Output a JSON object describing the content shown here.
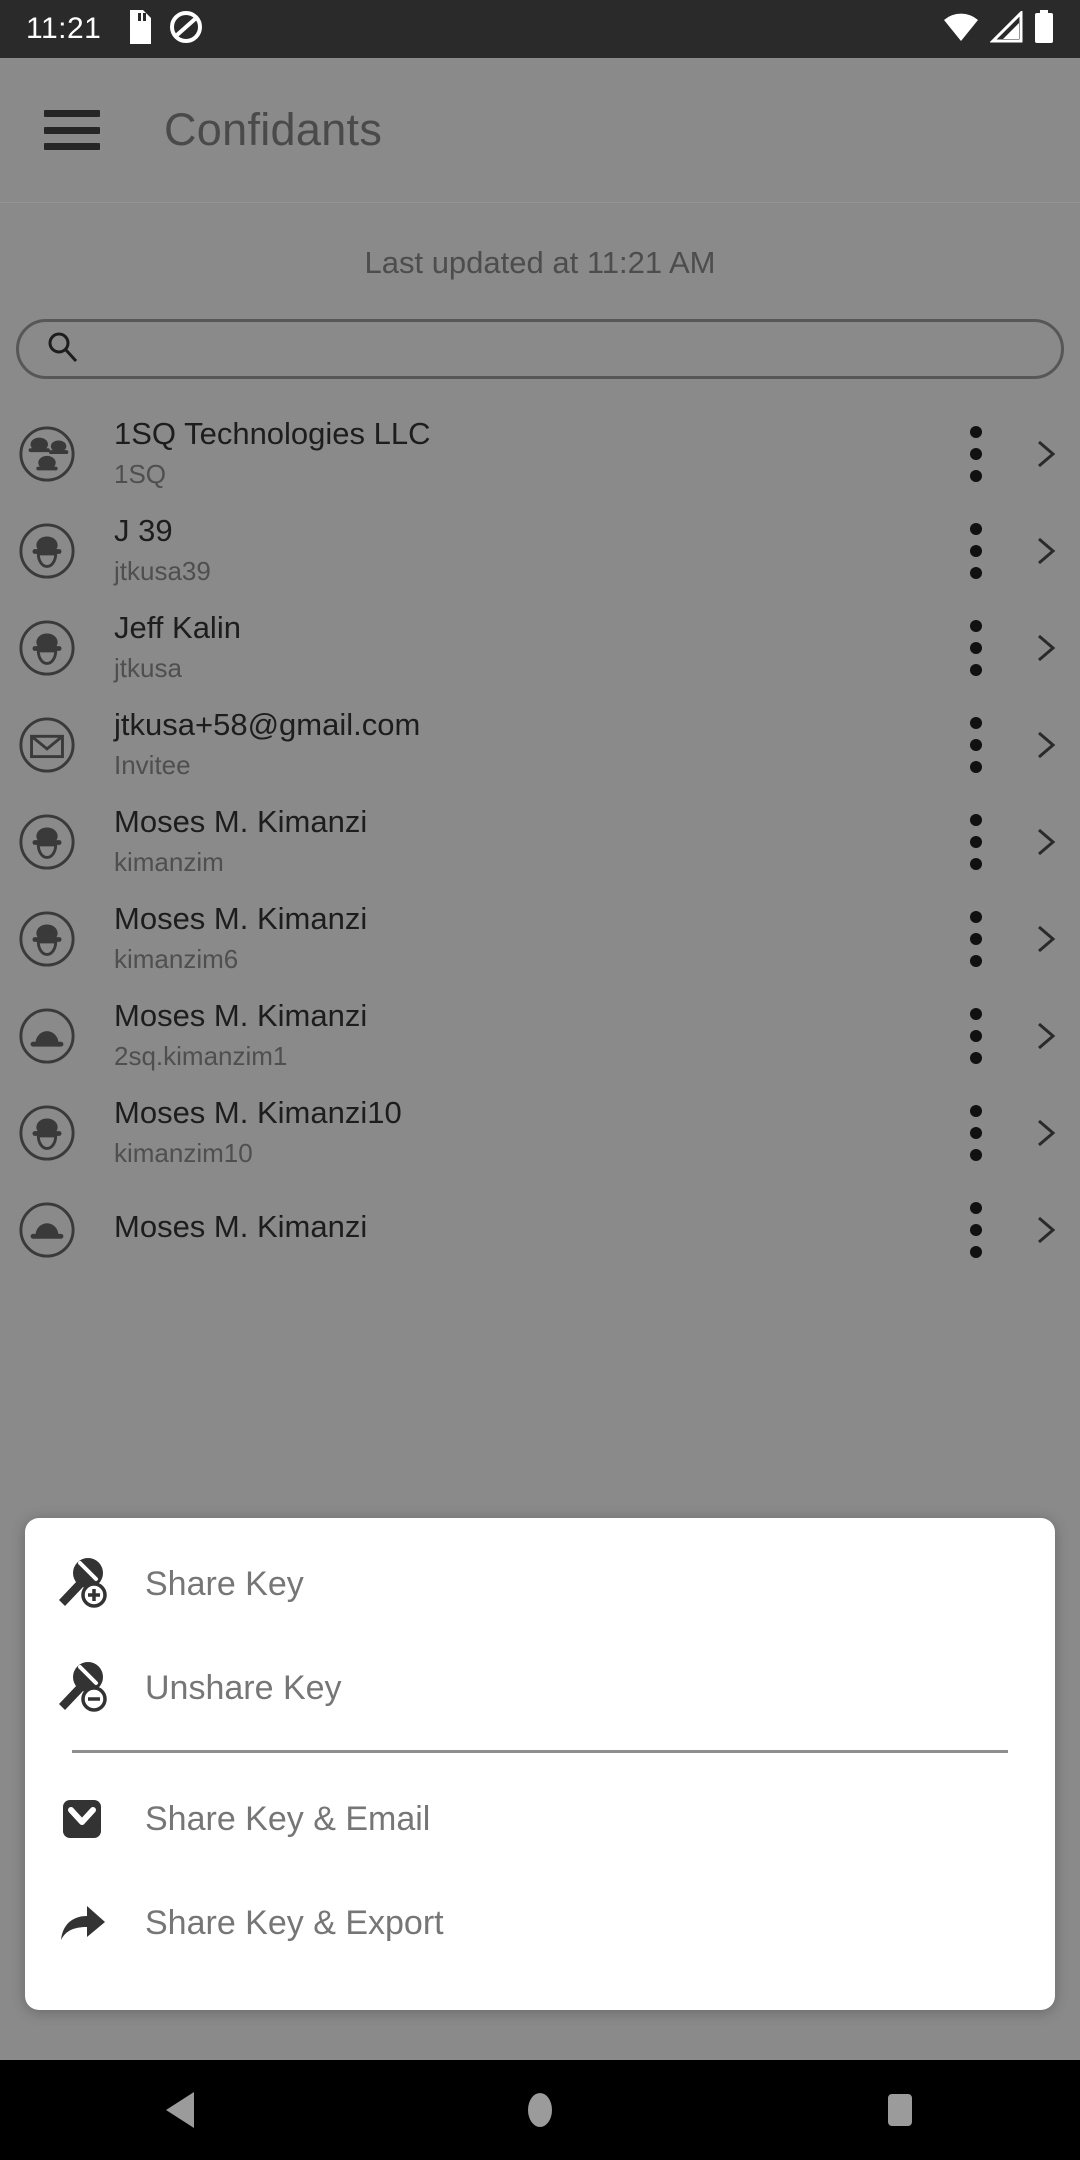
{
  "statusbar": {
    "time": "11:21",
    "icons_left": [
      "sd-card-icon",
      "do-not-disturb-icon"
    ],
    "icons_right": [
      "wifi-icon",
      "cellular-signal-icon",
      "battery-icon"
    ]
  },
  "appbar": {
    "menu_icon": "hamburger-menu-icon",
    "title": "Confidants"
  },
  "main": {
    "last_updated": "Last updated at 11:21 AM",
    "search": {
      "icon": "search-icon",
      "value": "",
      "placeholder": ""
    },
    "rows": [
      {
        "icon": "group-avatar-icon",
        "title": "1SQ Technologies LLC",
        "subtitle": "1SQ"
      },
      {
        "icon": "person-avatar-icon",
        "title": "J 39",
        "subtitle": "jtkusa39"
      },
      {
        "icon": "person-avatar-icon",
        "title": "Jeff Kalin",
        "subtitle": "jtkusa"
      },
      {
        "icon": "envelope-avatar-icon",
        "title": "jtkusa+58@gmail.com",
        "subtitle": "Invitee"
      },
      {
        "icon": "person-avatar-icon",
        "title": "Moses M. Kimanzi",
        "subtitle": "kimanzim"
      },
      {
        "icon": "person-avatar-icon",
        "title": "Moses M. Kimanzi",
        "subtitle": "kimanzim6"
      },
      {
        "icon": "hat-avatar-icon",
        "title": "Moses M. Kimanzi",
        "subtitle": "2sq.kimanzim1"
      },
      {
        "icon": "person-avatar-icon",
        "title": "Moses M. Kimanzi10",
        "subtitle": "kimanzim10"
      },
      {
        "icon": "hat-avatar-icon",
        "title": "Moses M. Kimanzi",
        "subtitle": ""
      }
    ],
    "row_action_icons": {
      "menu": "kebab-menu-icon",
      "chevron": "chevron-right-icon"
    }
  },
  "dialog": {
    "items": [
      {
        "icon": "key-plus-icon",
        "label": "Share Key"
      },
      {
        "icon": "key-minus-icon",
        "label": "Unshare Key"
      }
    ],
    "items_secondary": [
      {
        "icon": "envelope-icon",
        "label": "Share Key & Email"
      },
      {
        "icon": "share-arrow-icon",
        "label": "Share Key & Export"
      }
    ]
  },
  "navbar": {
    "back": "back-triangle-icon",
    "home": "home-circle-icon",
    "recents": "recents-square-icon"
  },
  "colors": {
    "statusbar_bg": "#2a2a2a",
    "scrim_bg": "#8a8a8a",
    "dialog_bg": "#ffffff",
    "dialog_text": "#767676",
    "navbar_bg": "#000000",
    "icon_dark": "#333333"
  }
}
